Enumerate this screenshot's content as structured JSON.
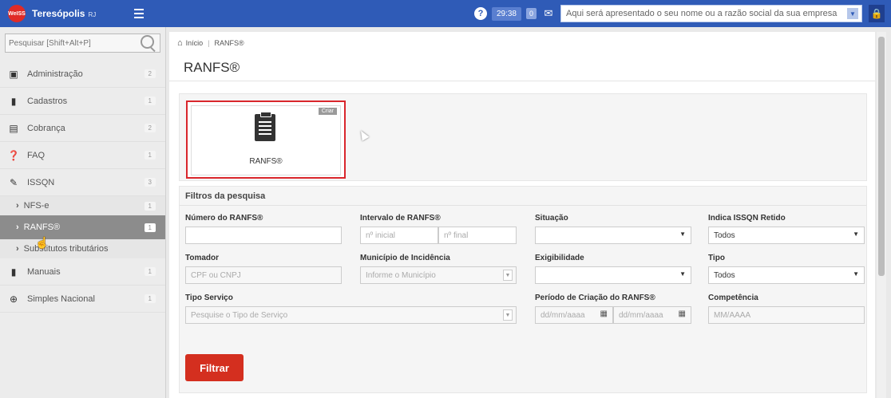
{
  "topbar": {
    "logo_text": "WeISS",
    "city": "Teresópolis",
    "state": "RJ",
    "help": "?",
    "timer": "29:38",
    "message_count": "0",
    "company_placeholder": "Aqui será apresentado o seu nome ou a razão social da sua empresa"
  },
  "sidebar": {
    "search_placeholder": "Pesquisar [Shift+Alt+P]",
    "items": [
      {
        "label": "Administração",
        "count": "2",
        "icon": "briefcase-icon"
      },
      {
        "label": "Cadastros",
        "count": "1",
        "icon": "book-icon"
      },
      {
        "label": "Cobrança",
        "count": "2",
        "icon": "calculator-icon"
      },
      {
        "label": "FAQ",
        "count": "1",
        "icon": "question-icon"
      },
      {
        "label": "ISSQN",
        "count": "3",
        "icon": "pencil-icon"
      }
    ],
    "subitems": [
      {
        "label": "NFS-e",
        "count": "1"
      },
      {
        "label": "RANFS®",
        "count": "1"
      },
      {
        "label": "Substitutos tributários"
      }
    ],
    "items2": [
      {
        "label": "Manuais",
        "count": "1",
        "icon": "book-icon"
      },
      {
        "label": "Simples Nacional",
        "count": "1",
        "icon": "globe-icon"
      }
    ]
  },
  "main": {
    "breadcrumb": {
      "home": "Início",
      "sep": "|",
      "current": "RANFS®"
    },
    "title": "RANFS®",
    "tile": {
      "label": "RANFS®",
      "create": "Criar"
    },
    "filters": {
      "title": "Filtros da pesquisa",
      "numero_label": "Número do RANFS®",
      "intervalo_label": "Intervalo de RANFS®",
      "intervalo_inicial": "nº inicial",
      "intervalo_final": "nº final",
      "situacao_label": "Situação",
      "issqn_retido_label": "Indica ISSQN Retido",
      "issqn_retido_value": "Todos",
      "tomador_label": "Tomador",
      "tomador_placeholder": "CPF ou CNPJ",
      "municipio_label": "Município de Incidência",
      "municipio_placeholder": "Informe o Município",
      "exigibilidade_label": "Exigibilidade",
      "tipo_label": "Tipo",
      "tipo_value": "Todos",
      "tipo_servico_label": "Tipo Serviço",
      "tipo_servico_placeholder": "Pesquise o Tipo de Serviço",
      "periodo_label": "Período de Criação do RANFS®",
      "periodo_de": "dd/mm/aaaa",
      "periodo_ate": "dd/mm/aaaa",
      "competencia_label": "Competência",
      "competencia_placeholder": "MM/AAAA",
      "filter_button": "Filtrar"
    }
  }
}
